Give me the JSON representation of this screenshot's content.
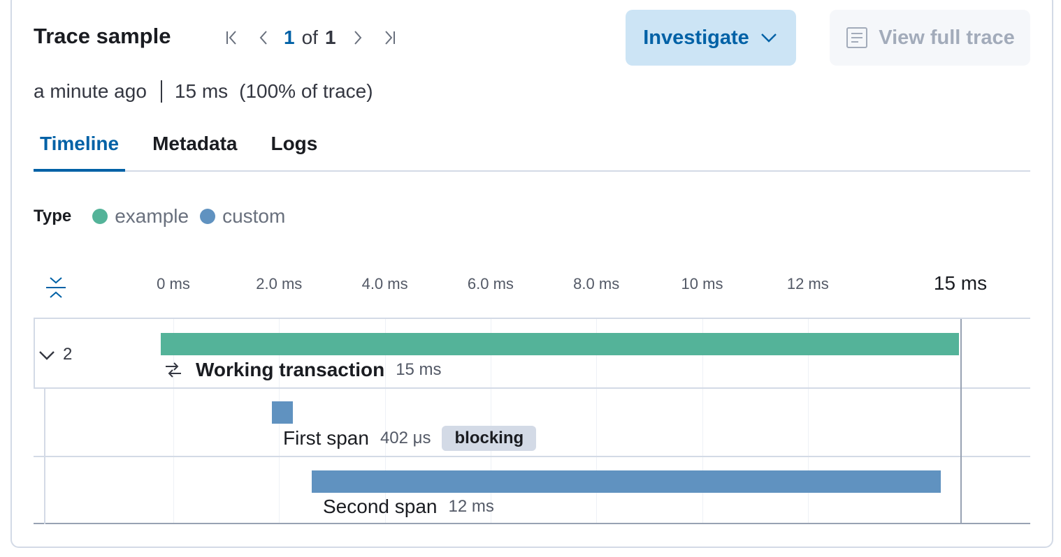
{
  "header": {
    "title": "Trace sample",
    "pager": {
      "current": "1",
      "of_label": "of",
      "total": "1"
    },
    "investigate_label": "Investigate",
    "view_full_trace_label": "View full trace"
  },
  "summary": {
    "time_ago": "a minute ago",
    "duration": "15 ms",
    "percent_of_trace": "(100% of trace)"
  },
  "tabs": [
    {
      "label": "Timeline",
      "active": true
    },
    {
      "label": "Metadata",
      "active": false
    },
    {
      "label": "Logs",
      "active": false
    }
  ],
  "legend": {
    "label": "Type",
    "items": [
      {
        "name": "example",
        "color": "#54b399"
      },
      {
        "name": "custom",
        "color": "#6092c0"
      }
    ]
  },
  "timeline": {
    "ticks": [
      "0 ms",
      "2.0 ms",
      "4.0 ms",
      "6.0 ms",
      "8.0 ms",
      "10 ms",
      "12 ms"
    ],
    "end_label": "15 ms"
  },
  "waterfall": {
    "child_count": "2",
    "items": [
      {
        "name": "Working transaction",
        "duration": "15 ms",
        "type": "example",
        "color": "#54b399",
        "start_ms": 0,
        "duration_ms": 15.1,
        "badge": ""
      },
      {
        "name": "First span",
        "duration": "402 μs",
        "type": "custom",
        "color": "#6092c0",
        "start_ms": 2.1,
        "duration_ms": 0.402,
        "badge": "blocking"
      },
      {
        "name": "Second span",
        "duration": "12 ms",
        "type": "custom",
        "color": "#6092c0",
        "start_ms": 2.85,
        "duration_ms": 11.9,
        "badge": ""
      }
    ]
  }
}
